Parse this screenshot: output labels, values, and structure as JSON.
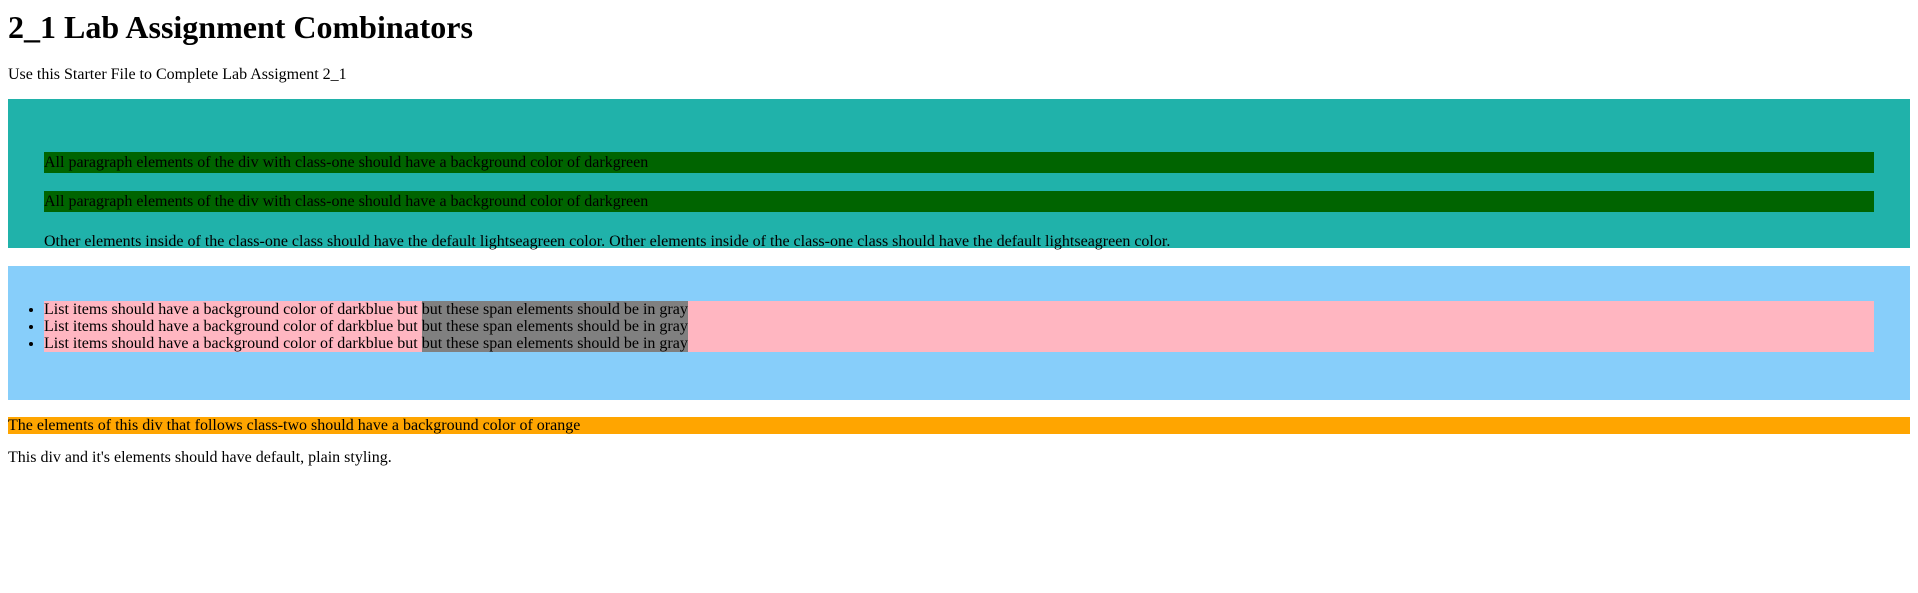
{
  "page": {
    "title": "2_1 Lab Assignment Combinators",
    "intro": "Use this Starter File to Complete Lab Assigment 2_1"
  },
  "class_one": {
    "paragraphs": [
      "All paragraph elements of the div with class-one should have a background color of darkgreen",
      "All paragraph elements of the div with class-one should have a background color of darkgreen"
    ],
    "other_text": "Other elements inside of the class-one class should have the default lightseagreen color. Other elements inside of the class-one class should have the default lightseagreen color."
  },
  "class_two": {
    "items": [
      {
        "text": "List items should have a background color of darkblue but ",
        "span": "but these span elements should be in gray"
      },
      {
        "text": "List items should have a background color of darkblue but ",
        "span": "but these span elements should be in gray"
      },
      {
        "text": "List items should have a background color of darkblue but ",
        "span": "but these span elements should be in gray"
      }
    ]
  },
  "following": {
    "orange_text": "The elements of this div that follows class-two should have a background color of orange",
    "plain_text": "This div and it's elements should have default, plain styling."
  },
  "colors": {
    "lightseagreen": "#20b2aa",
    "darkgreen": "#006400",
    "lightskyblue": "#87cefa",
    "lightpink": "#ffb6c1",
    "gray": "#808080",
    "orange": "#ffa500"
  }
}
